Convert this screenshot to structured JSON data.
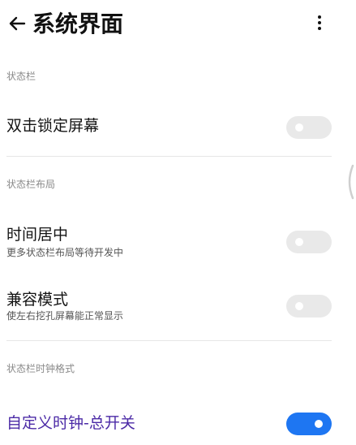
{
  "header": {
    "title": "系统界面"
  },
  "sections": [
    {
      "label": "状态栏"
    },
    {
      "label": "状态栏布局"
    },
    {
      "label": "状态栏时钟格式"
    }
  ],
  "rows": {
    "double_tap_lock": {
      "title": "双击锁定屏幕",
      "enabled": false
    },
    "center_clock": {
      "title": "时间居中",
      "subtitle": "更多状态栏布局等待开发中",
      "enabled": false
    },
    "compat_mode": {
      "title": "兼容模式",
      "subtitle": "使左右挖孔屏幕能正常显示",
      "enabled": false
    },
    "custom_clock": {
      "title": "自定义时钟-总开关",
      "enabled": true
    }
  },
  "colors": {
    "accent": "#4b2aa6",
    "toggle_on": "#1e76f2",
    "toggle_off": "#e9e9e9"
  },
  "icons": {
    "back": "arrow-left-icon",
    "menu": "more-vertical-icon"
  }
}
